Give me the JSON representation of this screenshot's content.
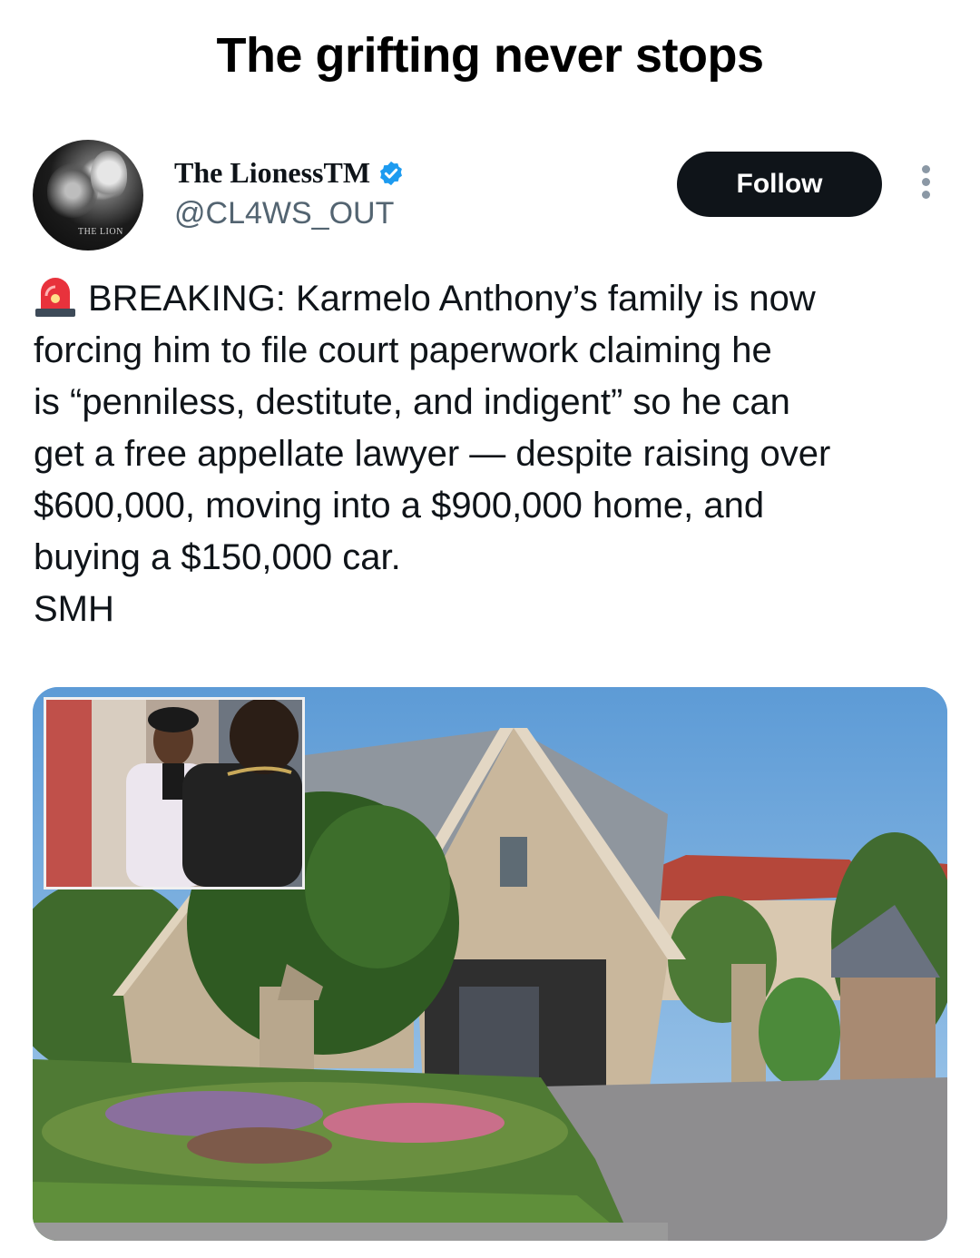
{
  "post": {
    "caption": "The grifting never stops"
  },
  "tweet": {
    "display_name": "The LionessTM",
    "handle": "@CL4WS_OUT",
    "avatar_mark": "THE LION",
    "follow_label": "Follow",
    "text_line_1": "BREAKING: Karmelo Anthony’s family is now",
    "text_body": "forcing him to file court paperwork claiming he\nis “penniless, destitute, and indigent” so he can\nget a free appellate lawyer — despite raising over\n$600,000, moving into a $900,000 home, and\nbuying a $150,000 car.\nSMH"
  },
  "icons": {
    "verified": "verified-badge-icon",
    "more": "more-options-icon",
    "siren": "police-siren-emoji"
  },
  "colors": {
    "follow_bg": "#0f1419",
    "verified": "#1d9bf0",
    "handle": "#536471"
  }
}
